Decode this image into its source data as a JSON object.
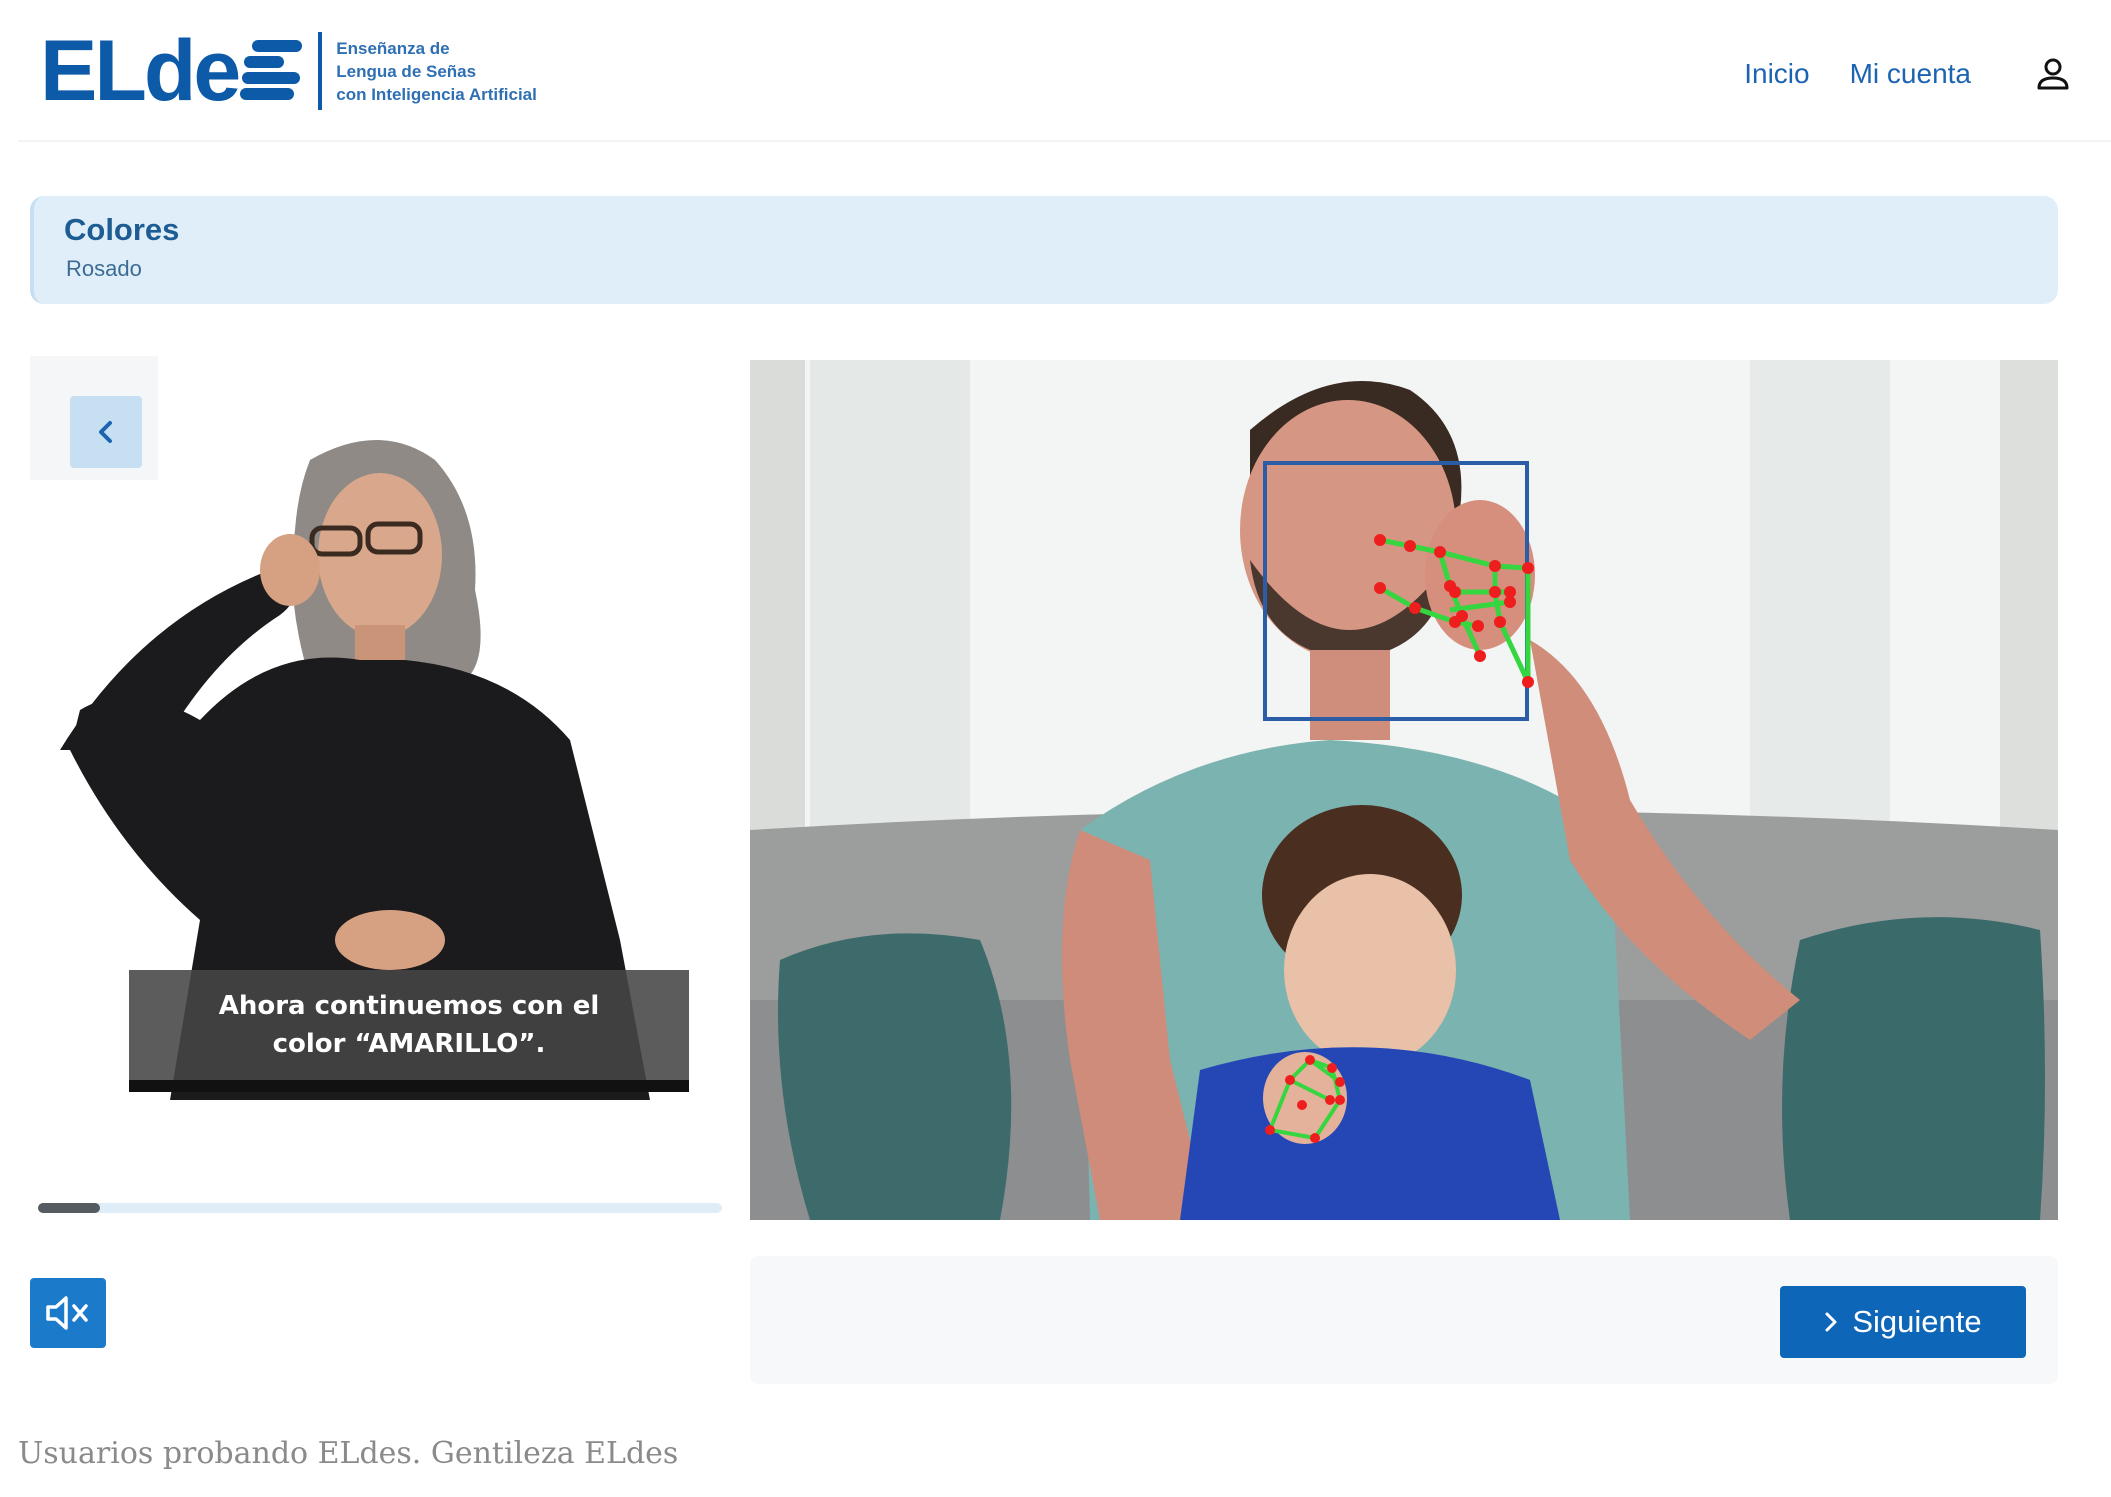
{
  "header": {
    "logo_word": "ELde",
    "logo_tagline": [
      "Enseñanza de",
      "Lengua de Señas",
      "con Inteligencia Artificial"
    ],
    "nav": [
      {
        "label": "Inicio"
      },
      {
        "label": "Mi cuenta"
      }
    ],
    "user_icon": "user-icon",
    "brand_color": "#0d5aa8"
  },
  "lesson": {
    "title": "Colores",
    "subtitle": "Rosado"
  },
  "left_panel": {
    "back_icon": "chevron-left-icon",
    "subtitle": "Ahora continuemos con el color “AMARILLO”.",
    "progress_fraction": 0.09,
    "mute_icon": "speaker-muted-icon"
  },
  "actions": {
    "next_label": "Siguiente",
    "next_icon": "chevron-right-icon",
    "accent": "#0d66b8"
  },
  "caption": "Usuarios probando ELdes. Gentileza ELdes"
}
